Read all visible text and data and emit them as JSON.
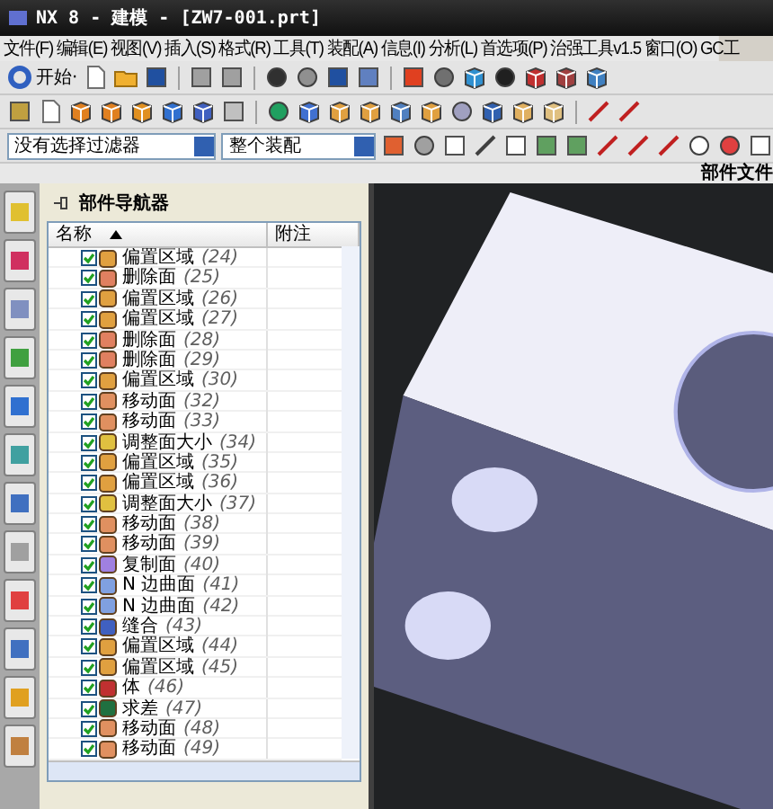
{
  "window": {
    "title": "NX 8 - 建模 - [ZW7-001.prt]"
  },
  "menu": [
    "文件(F)",
    "编辑(E)",
    "视图(V)",
    "插入(S)",
    "格式(R)",
    "工具(T)",
    "装配(A)",
    "信息(I)",
    "分析(L)",
    "首选项(P)",
    "治强工具v1.5",
    "窗口(O)",
    "GC工"
  ],
  "toolbar": {
    "start_button": "开始·"
  },
  "selection_bar": {
    "filter": "没有选择过滤器",
    "scope": "整个装配"
  },
  "part_file_label": "部件文件",
  "navigator": {
    "title": "部件导航器",
    "columns": [
      "名称",
      "附注"
    ],
    "rows": [
      {
        "label": "偏置区域",
        "number": "(24)",
        "kind": "offset",
        "checked": true
      },
      {
        "label": "删除面",
        "number": "(25)",
        "kind": "delete",
        "checked": true
      },
      {
        "label": "偏置区域",
        "number": "(26)",
        "kind": "offset",
        "checked": true
      },
      {
        "label": "偏置区域",
        "number": "(27)",
        "kind": "offset",
        "checked": true
      },
      {
        "label": "删除面",
        "number": "(28)",
        "kind": "delete",
        "checked": true
      },
      {
        "label": "删除面",
        "number": "(29)",
        "kind": "delete",
        "checked": true
      },
      {
        "label": "偏置区域",
        "number": "(30)",
        "kind": "offset",
        "checked": true
      },
      {
        "label": "移动面",
        "number": "(32)",
        "kind": "move",
        "checked": true
      },
      {
        "label": "移动面",
        "number": "(33)",
        "kind": "move",
        "checked": true
      },
      {
        "label": "调整面大小",
        "number": "(34)",
        "kind": "resize",
        "checked": true
      },
      {
        "label": "偏置区域",
        "number": "(35)",
        "kind": "offset",
        "checked": true
      },
      {
        "label": "偏置区域",
        "number": "(36)",
        "kind": "offset",
        "checked": true
      },
      {
        "label": "调整面大小",
        "number": "(37)",
        "kind": "resize",
        "checked": true
      },
      {
        "label": "移动面",
        "number": "(38)",
        "kind": "move",
        "checked": true
      },
      {
        "label": "移动面",
        "number": "(39)",
        "kind": "move",
        "checked": true
      },
      {
        "label": "复制面",
        "number": "(40)",
        "kind": "copy",
        "checked": true
      },
      {
        "label": "N 边曲面",
        "number": "(41)",
        "kind": "nsided",
        "checked": true
      },
      {
        "label": "N 边曲面",
        "number": "(42)",
        "kind": "nsided",
        "checked": true
      },
      {
        "label": "缝合",
        "number": "(43)",
        "kind": "sew",
        "checked": true
      },
      {
        "label": "偏置区域",
        "number": "(44)",
        "kind": "offset",
        "checked": true
      },
      {
        "label": "偏置区域",
        "number": "(45)",
        "kind": "offset",
        "checked": true
      },
      {
        "label": "体",
        "number": "(46)",
        "kind": "body",
        "checked": true
      },
      {
        "label": "求差",
        "number": "(47)",
        "kind": "subtract",
        "checked": true
      },
      {
        "label": "移动面",
        "number": "(48)",
        "kind": "move",
        "checked": true
      },
      {
        "label": "移动面",
        "number": "(49)",
        "kind": "move",
        "checked": true
      }
    ]
  }
}
